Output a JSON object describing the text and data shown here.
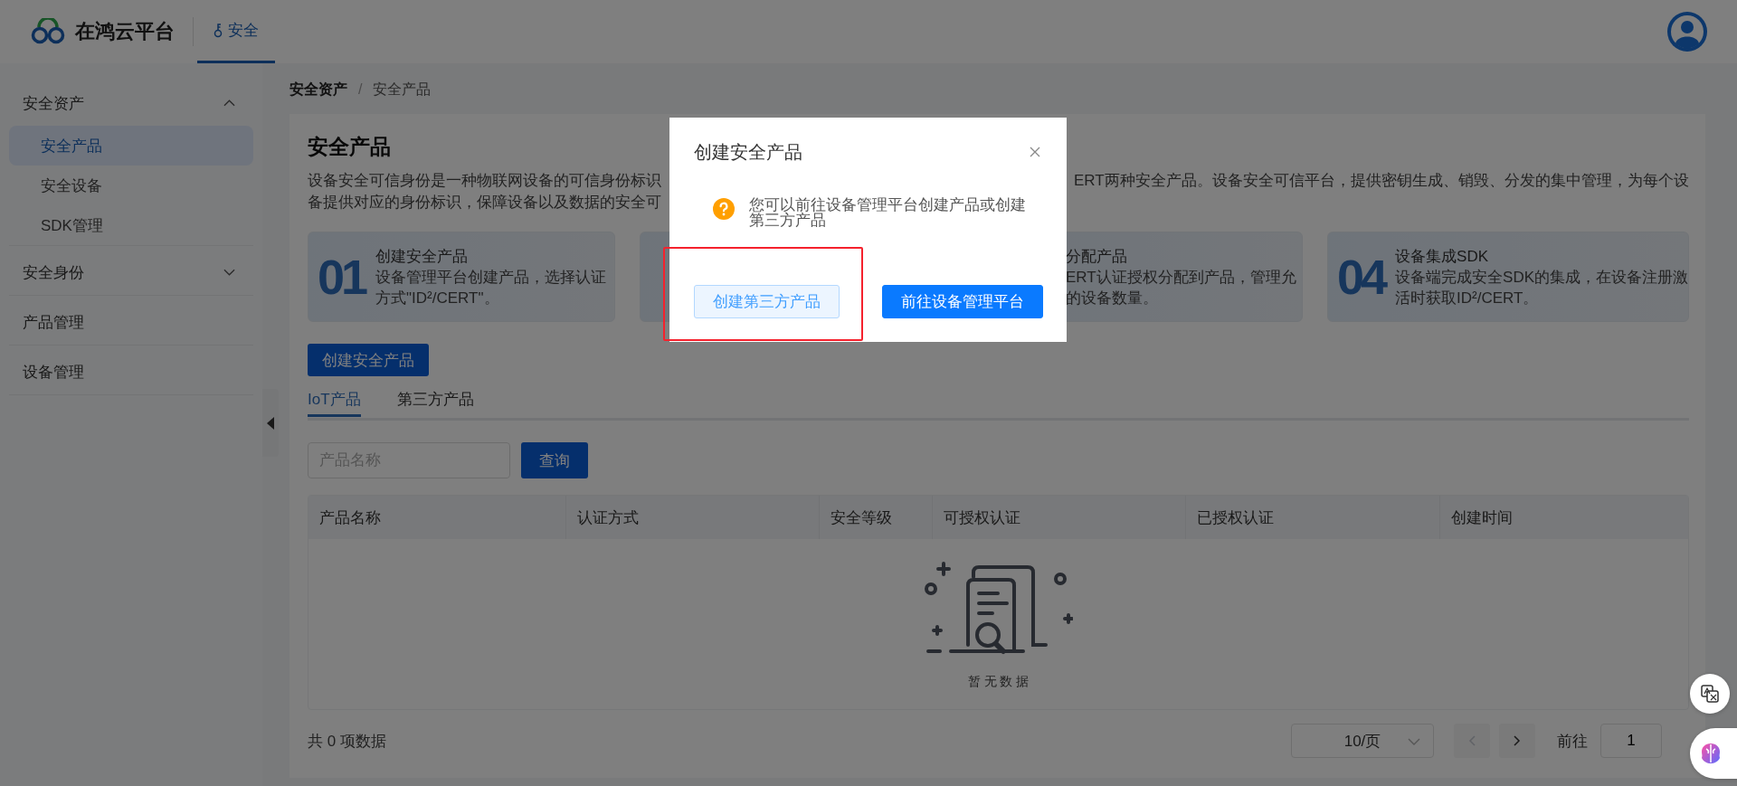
{
  "header": {
    "logo_text": "在鸿云平台",
    "nav_tabs": [
      {
        "label": "安全",
        "selected": true
      }
    ]
  },
  "sidebar": {
    "items": [
      {
        "label": "安全资产",
        "expanded": true,
        "selected": false,
        "children": [
          {
            "label": "安全产品",
            "selected": true
          },
          {
            "label": "安全设备",
            "selected": false
          },
          {
            "label": "SDK管理",
            "selected": false
          }
        ]
      },
      {
        "label": "安全身份",
        "expanded": false,
        "selected": false
      },
      {
        "label": "产品管理",
        "selected": false
      },
      {
        "label": "设备管理",
        "selected": false
      }
    ]
  },
  "breadcrumb": {
    "items": [
      "安全资产",
      "安全产品"
    ],
    "separator": "/"
  },
  "page": {
    "title": "安全产品",
    "description": {
      "left_lines": [
        "设备安全可信身份是一种物联网设备的可信身份标识",
        "备提供对应的身份标识，保障设备以及数据的安全可"
      ],
      "right_lines": [
        "ERT两种安全产品。设备安全可信平台，提供密钥生成、销毁、分发的集中管理，为每个设"
      ]
    }
  },
  "steps": [
    {
      "kind": "numbered",
      "number": "01",
      "title": "创建安全产品",
      "lines": [
        "设备管理平台创建产品，选择认证",
        "方式\"ID²/CERT\"。"
      ]
    },
    {
      "kind": "blank"
    },
    {
      "kind": "partial",
      "title": "分配产品",
      "lines": [
        "ERT认证授权分配到产品，管理允",
        "的设备数量。"
      ]
    },
    {
      "kind": "numbered",
      "number": "04",
      "title": "设备集成SDK",
      "lines": [
        "设备端完成安全SDK的集成，在设备注册激",
        "活时获取ID²/CERT。"
      ]
    }
  ],
  "create_button": "创建安全产品",
  "tabs": [
    {
      "label": "IoT产品",
      "selected": true
    },
    {
      "label": "第三方产品",
      "selected": false
    }
  ],
  "search": {
    "placeholder": "产品名称",
    "button": "查询"
  },
  "table": {
    "columns": [
      "产品名称",
      "认证方式",
      "安全等级",
      "可授权认证",
      "已授权认证",
      "创建时间"
    ],
    "empty_text": "暂 无 数 据"
  },
  "footer": {
    "total": "共 0 项数据",
    "page_size": "10/页",
    "prev_disabled": true,
    "next_disabled": false,
    "goto_label": "前往",
    "page_input": "1"
  },
  "dialog": {
    "title": "创建安全产品",
    "message": "您可以前往设备管理平台创建产品或创建第三方产品",
    "buttons": [
      {
        "label": "创建第三方产品",
        "kind": "secondary",
        "highlighted": true
      },
      {
        "label": "前往设备管理平台",
        "kind": "primary",
        "highlighted": false
      }
    ]
  }
}
